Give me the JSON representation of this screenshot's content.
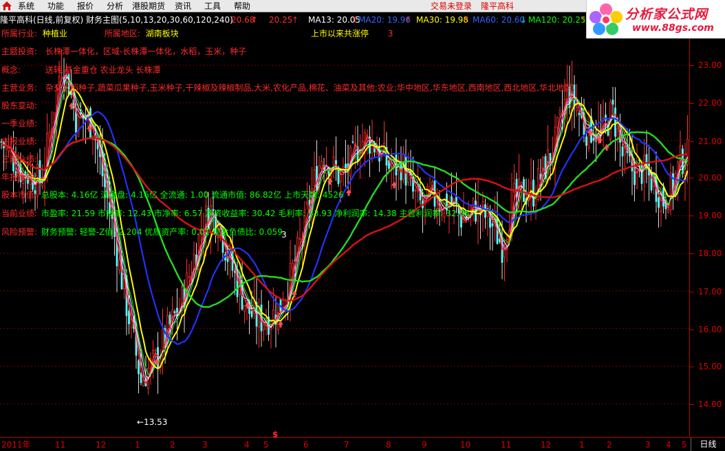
{
  "menu": {
    "items": [
      "系统",
      "功能",
      "报价",
      "分析",
      "港股期货",
      "资讯",
      "工具",
      "帮助"
    ],
    "trade_status": "交易未登录",
    "stock_name": "隆平高科"
  },
  "brand": {
    "title": "分析家公式网",
    "url": "www.88gs.com"
  },
  "header": {
    "chart_title": "隆平高科(日线,前复权) 财务主图(5,10,13,20,30,60,120,240)",
    "price1": "20.68",
    "price2": "20.25",
    "ma": [
      {
        "label": "MA13: 20.05",
        "color": "#ffffff"
      },
      {
        "label": "MA20: 19.96",
        "color": "#3366ff"
      },
      {
        "label": "MA30: 19.98",
        "color": "#ffff00"
      },
      {
        "label": "MA60: 20.60",
        "color": "#3366ff"
      },
      {
        "label": "MA120: 20.25",
        "color": "#00ff00"
      }
    ]
  },
  "info": {
    "industry_label": "所属行业:",
    "industry_value": "种植业",
    "region_label": "所属地区:",
    "region_value": "湖南板块",
    "limit_up_label": "上市以来共涨停",
    "limit_up_value": "3",
    "theme_label": "主题投资:",
    "theme_value": "长株潭一体化，区域-长株潭一体化，水稻，玉米，种子",
    "concept_label": "概念:",
    "concept_value": "送转 基金重仓 农业龙头 长株潭",
    "business_label": "主营业务:",
    "business_value": "杂交水稻种子,蔬菜瓜果种子,玉米种子,干辣椒及辣椒制品,大米,农化产品,棉花、油菜及其他;农业;华中地区,华东地区,西南地区,西北地区,华北地区,",
    "shareholder_label": "股东变动:",
    "q1_label": "一季业绩:",
    "half_label": "中报业绩:",
    "q3_label": "三季业绩:",
    "annual_label": "年报业绩:",
    "capital_label": "股本市值:",
    "capital_value": "总股本: 4.16亿 流通盘: 4.16亿 全流通: 1.00 流通市值: 86.82亿 上市天数: 4526",
    "current_label": "当前业绩:",
    "current_value": "市盈率: 21.59 市销率: 12.43 市净率: 6.57 净资收益率: 30.42 毛利率: 33.93 净利润率: 14.38 主营利润率: 32.06",
    "risk_label": "风险预警:",
    "risk_value": "财务预警: 轻警-Z值: 2.204 优质资产率: 0.01 现金负债比: 0.059",
    "low_marker": "←13.53",
    "count_marker": "3",
    "dollar_marker": "$"
  },
  "chart_data": {
    "type": "candlestick",
    "y_ticks": [
      "23.00",
      "22.00",
      "21.00",
      "20.00",
      "19.00",
      "18.00",
      "17.00",
      "16.00",
      "15.00",
      "14.00"
    ],
    "ylim": [
      13.1,
      23.9
    ],
    "low": 13.53,
    "x_ticks": [
      "2011年",
      "11",
      "12",
      "1",
      "2",
      "3",
      "4",
      "5",
      "6",
      "7",
      "8",
      "9",
      "10",
      "11",
      "12",
      "1",
      "2",
      "3",
      "4",
      "5"
    ],
    "period": "日线",
    "grid": true
  }
}
